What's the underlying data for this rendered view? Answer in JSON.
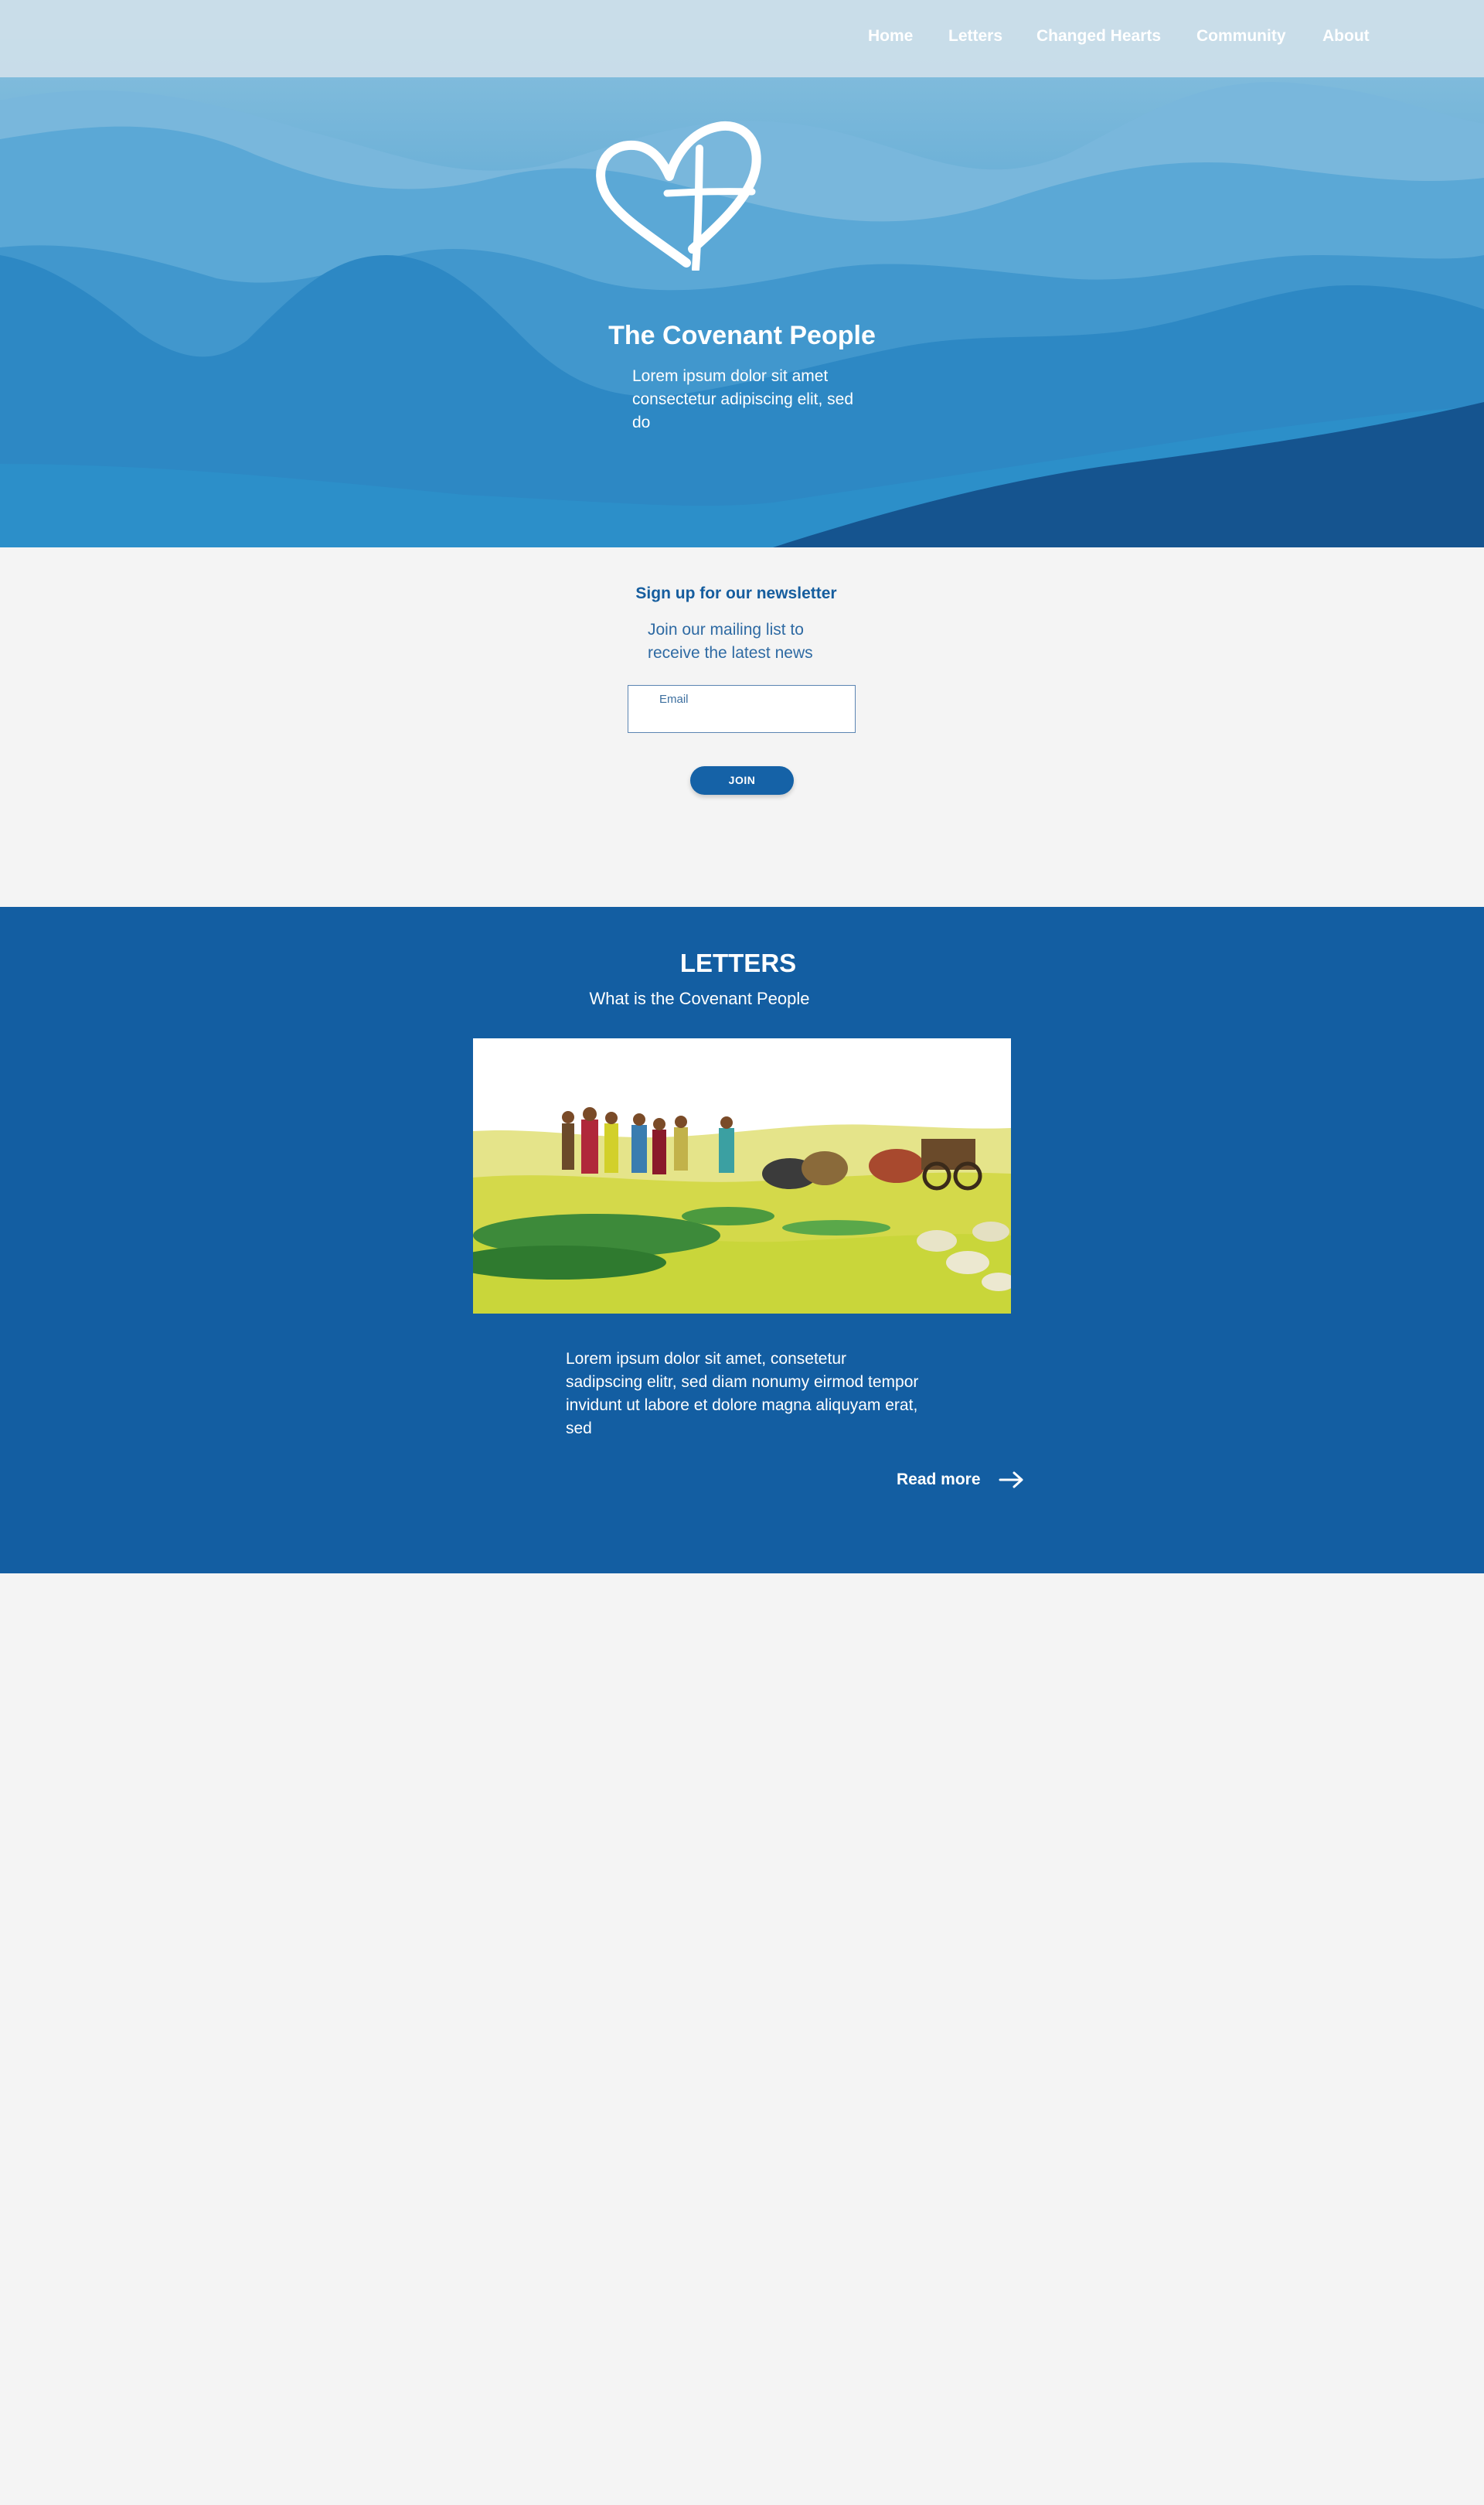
{
  "nav": {
    "items": [
      {
        "label": "Home"
      },
      {
        "label": "Letters"
      },
      {
        "label": "Changed Hearts"
      },
      {
        "label": "Community"
      },
      {
        "label": "About"
      }
    ]
  },
  "hero": {
    "logo_icon": "heart-cross-icon",
    "title": "The Covenant People",
    "subtitle": "Lorem ipsum dolor sit amet consectetur adipiscing elit, sed do"
  },
  "newsletter": {
    "title": "Sign up for our newsletter",
    "subtitle": "Join our mailing list to receive the latest news",
    "email_label": "Email",
    "email_value": "",
    "join_label": "JOIN"
  },
  "letters": {
    "title": "LETTERS",
    "subtitle": "What is the Covenant People",
    "image_icon": "caravan-illustration",
    "excerpt": "Lorem ipsum dolor sit amet, consetetur sadipscing elitr, sed diam nonumy eirmod tempor invidunt ut labore et dolore magna aliquyam erat, sed",
    "read_more": "Read more",
    "read_more_icon": "arrow-right-icon"
  },
  "colors": {
    "brand_blue": "#135ea2",
    "page_bg": "#f4f4f4",
    "navbar_bg": "#cddfe9",
    "text_white": "#ffffff"
  }
}
